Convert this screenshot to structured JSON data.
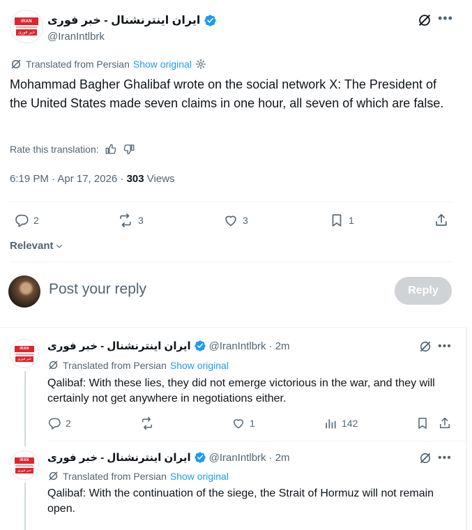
{
  "main_tweet": {
    "display_name": "ایران اینترنشنال - خبر فوری",
    "handle": "@IranIntlbrk",
    "translated_label": "Translated from Persian",
    "show_original": "Show original",
    "text": "Mohammad Bagher Ghalibaf wrote on the social network X: The President of the United States made seven claims in one hour, all seven of which are false.",
    "rate_label": "Rate this translation:",
    "timestamp": "6:19 PM · Apr 17, 2026 · ",
    "views_count": "303",
    "views_label": " Views",
    "actions": {
      "replies": "2",
      "reposts": "3",
      "likes": "3",
      "bookmarks": "1"
    }
  },
  "sort": {
    "label": "Relevant"
  },
  "composer": {
    "placeholder": "Post your reply",
    "reply_button": "Reply"
  },
  "logo": {
    "top": "IRAN",
    "bottom": "خبر فوری"
  },
  "replies": [
    {
      "display_name": "ایران اینترنشنال - خبر فوری",
      "handle": "@IranIntlbrk",
      "time": "· 2m",
      "translated_label": "Translated from Persian",
      "show_original": "Show original",
      "text": "Qalibaf: With these lies, they did not emerge victorious in the war, and they will certainly not get anywhere in negotiations either.",
      "actions": {
        "replies": "2",
        "reposts": "",
        "likes": "1",
        "views": "142"
      }
    },
    {
      "display_name": "ایران اینترنشنال - خبر فوری",
      "handle": "@IranIntlbrk",
      "time": "· 2m",
      "translated_label": "Translated from Persian",
      "show_original": "Show original",
      "text": "Qalibaf: With the continuation of the siege, the Strait of Hormuz will not remain open."
    }
  ],
  "colors": {
    "accent": "#1d9bf0",
    "muted": "#536471",
    "text": "#0f1419",
    "verified": "#1d9bf0",
    "logo_red": "#e0242c"
  }
}
